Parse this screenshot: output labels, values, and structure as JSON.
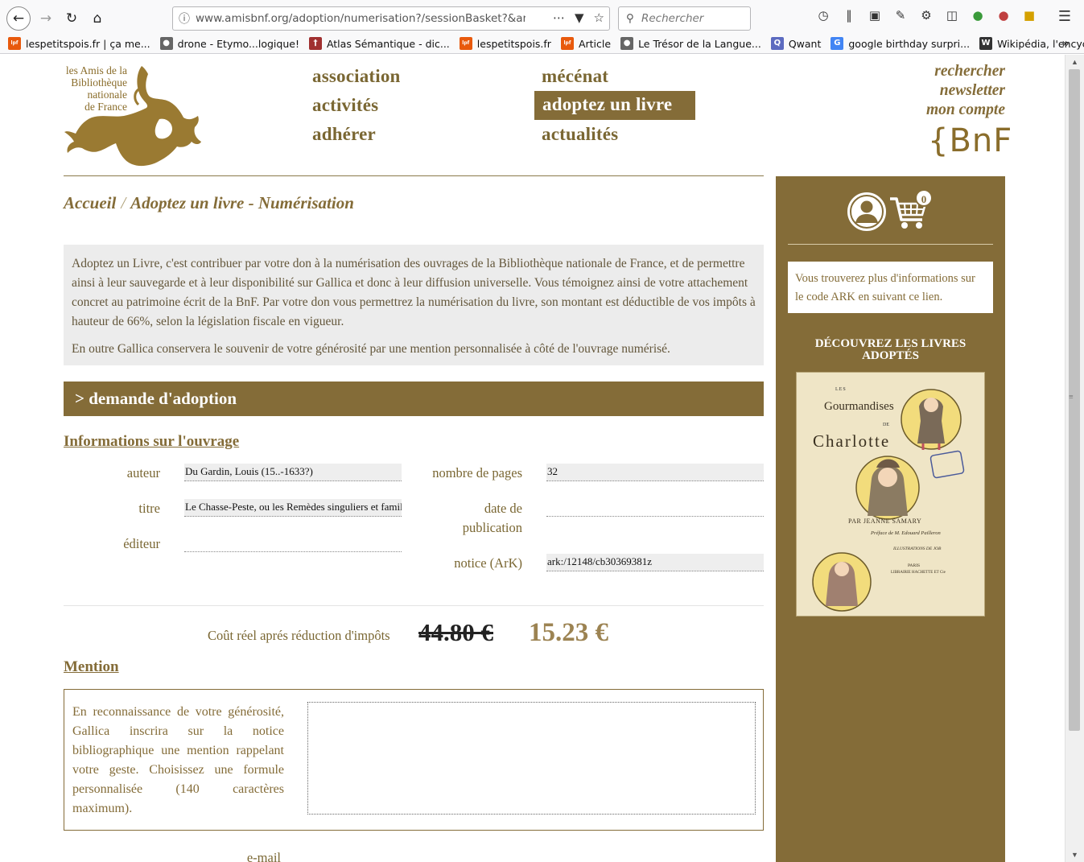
{
  "browser": {
    "url": "www.amisbnf.org/adoption/numerisation?/sessionBasket?&arkn",
    "search_placeholder": "Rechercher",
    "bookmarks": [
      {
        "label": "lespetitspois.fr | ça me...",
        "icon": "lespetitspois-icon",
        "color": "#e8590c"
      },
      {
        "label": "drone - Etymo...logique!",
        "icon": "globe-icon",
        "color": "#666666"
      },
      {
        "label": "Atlas Sémantique - dic...",
        "icon": "atlas-icon",
        "color": "#a03030"
      },
      {
        "label": "lespetitspois.fr",
        "icon": "lespetitspois-icon",
        "color": "#e8590c"
      },
      {
        "label": "Article",
        "icon": "lespetitspois-icon",
        "color": "#e8590c"
      },
      {
        "label": "Le Trésor de la Langue...",
        "icon": "globe-icon",
        "color": "#666666"
      },
      {
        "label": "Qwant",
        "icon": "qwant-icon",
        "color": "#5c6bc0"
      },
      {
        "label": "google birthday surpri...",
        "icon": "google-icon",
        "color": "#4285f4"
      },
      {
        "label": "Wikipédia, l'encyclopé...",
        "icon": "wikipedia-icon",
        "color": "#333333"
      }
    ]
  },
  "site": {
    "logo_lines": [
      "les Amis de la",
      "Bibliothèque",
      "nationale",
      "de France"
    ],
    "nav": {
      "association": "association",
      "activites": "activités",
      "adherer": "adhérer",
      "mecenat": "mécénat",
      "adoptez": "adoptez un livre",
      "actualites": "actualités"
    },
    "top_links": {
      "rechercher": "rechercher",
      "newsletter": "newsletter",
      "compte": "mon compte"
    },
    "bnf_logo": "{BnF"
  },
  "breadcrumb": {
    "home": "Accueil",
    "separator": "/",
    "current": "Adoptez un livre - Numérisation"
  },
  "intro": {
    "p1": "Adoptez un Livre, c'est contribuer par votre don à la numérisation des ouvrages de la Bibliothèque nationale de France, et de permettre ainsi à leur sauvegarde et à leur disponibilité sur Gallica et donc à leur diffusion universelle. Vous témoignez ainsi de votre attachement concret au patrimoine écrit de la BnF. Par votre don vous permettrez la numérisation du livre, son montant est déductible de vos impôts à hauteur de 66%, selon la législation fiscale en vigueur.",
    "p2": "En outre Gallica conservera le souvenir de votre générosité par une mention personnalisée à côté de l'ouvrage numérisé."
  },
  "section_header": "> demande d'adoption",
  "info": {
    "title": "Informations sur l'ouvrage",
    "auteur_label": "auteur",
    "auteur_value": "Du Gardin, Louis (15..-1633?)",
    "titre_label": "titre",
    "titre_value": "Le Chasse-Peste, ou les Remèdes singuliers et familie",
    "editeur_label": "éditeur",
    "editeur_value": "",
    "pages_label": "nombre de pages",
    "pages_value": "32",
    "date_label_1": "date de",
    "date_label_2": "publication",
    "date_value": "",
    "ark_label": "notice (ArK)",
    "ark_value": "ark:/12148/cb30369381z"
  },
  "cost": {
    "label": "Coût réel aprés réduction d'impôts",
    "old_price": "44.80 €",
    "new_price": "15.23 €"
  },
  "mention": {
    "title": "Mention",
    "text": "En reconnaissance de votre générosité, Gallica inscrira sur la notice bibliographique une mention rappelant votre geste. Choisissez une formule personnalisée (140 caractères maximum).",
    "value": ""
  },
  "email_label": "e-mail",
  "sidebar": {
    "cart_count": "0",
    "ark_info": "Vous trouverez plus d'informations sur le code ARK en suivant ce lien.",
    "discover_title": "DÉCOUVREZ LES LIVRES ADOPTÉS",
    "book": {
      "les": "LES",
      "title_1": "Gourmandises",
      "de": "DE",
      "title_2": "Charlotte",
      "author": "PAR JEANNE SAMARY",
      "preface": "Préface de M. Edouard Pailleron",
      "illus": "ILLUSTRATIONS DE JOB",
      "city": "PARIS",
      "publisher": "LIBRAIRIE HACHETTE ET Cie"
    }
  },
  "colors": {
    "brand": "#846c38",
    "brand_text": "#7a6733",
    "price_new": "#9c8352"
  }
}
